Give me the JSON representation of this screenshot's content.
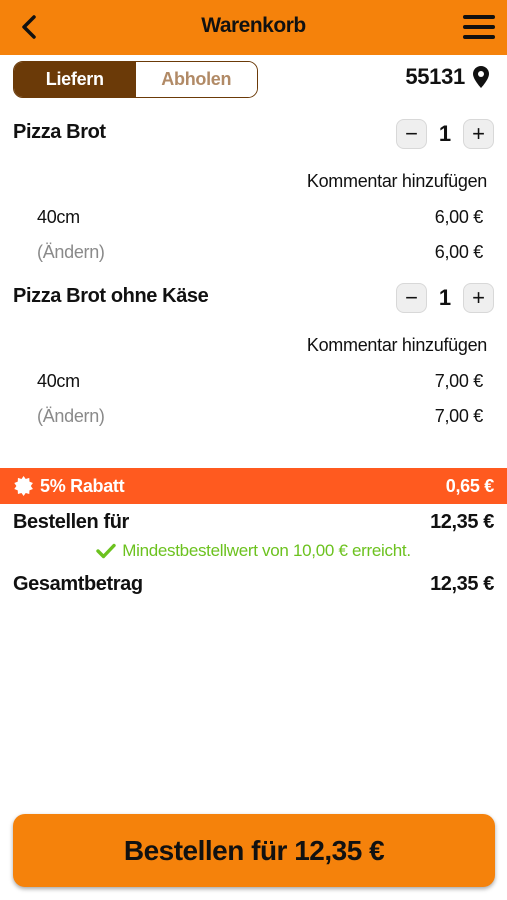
{
  "header": {
    "title": "Warenkorb",
    "back_icon": "chevron-left-icon",
    "menu_icon": "hamburger-menu-icon"
  },
  "delivery_toggle": {
    "options": [
      "Liefern",
      "Abholen"
    ],
    "selected": "Liefern"
  },
  "location": {
    "zip": "55131",
    "icon": "map-pin-icon"
  },
  "cart": {
    "items": [
      {
        "name": "Pizza Brot",
        "quantity": "1",
        "comment_label": "Kommentar hinzufügen",
        "size": "40cm",
        "size_price": "6,00 €",
        "change_label": "(Ändern)",
        "item_total": "6,00 €"
      },
      {
        "name": "Pizza Brot ohne Käse",
        "quantity": "1",
        "comment_label": "Kommentar hinzufügen",
        "size": "40cm",
        "size_price": "7,00 €",
        "change_label": "(Ändern)",
        "item_total": "7,00 €"
      }
    ],
    "minus_symbol": "−",
    "plus_symbol": "+"
  },
  "discount": {
    "label": "5% Rabatt",
    "amount": "0,65 €",
    "icon": "badge-icon"
  },
  "summary": {
    "order_for_label": "Bestellen für",
    "order_for_value": "12,35 €",
    "minimum_message": "Mindestbestellwert von 10,00 € erreicht.",
    "total_label": "Gesamtbetrag",
    "total_value": "12,35 €"
  },
  "order_button": {
    "label": "Bestellen für 12,35 €"
  },
  "colors": {
    "brand_orange": "#f5820b",
    "toggle_brown": "#6b3a08",
    "discount_red": "#ff5a1f",
    "success_green": "#6cc21f"
  }
}
